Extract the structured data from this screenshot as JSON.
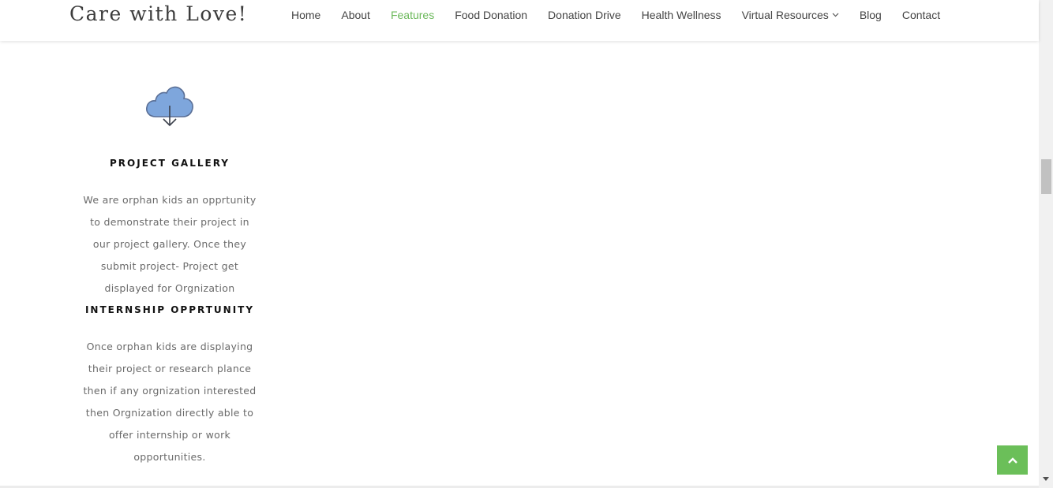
{
  "site": {
    "logo_text": "Care with Love!"
  },
  "nav": {
    "items": [
      {
        "label": "Home",
        "active": false
      },
      {
        "label": "About",
        "active": false
      },
      {
        "label": "Features",
        "active": true
      },
      {
        "label": "Food Donation",
        "active": false
      },
      {
        "label": "Donation Drive",
        "active": false
      },
      {
        "label": "Health Wellness",
        "active": false
      },
      {
        "label": "Virtual Resources",
        "active": false,
        "dropdown": true
      },
      {
        "label": "Blog",
        "active": false
      },
      {
        "label": "Contact",
        "active": false
      }
    ],
    "active_color": "#6bb85a"
  },
  "features": {
    "icon": "cloud-download-icon",
    "items": [
      {
        "title": "PROJECT GALLERY",
        "lines": [
          "We are orphan kids an opprtunity",
          "to demonstrate their project in",
          "our project gallery. Once they",
          "submit project- Project get",
          "displayed for Orgnization"
        ]
      },
      {
        "title": "INTERNSHIP OPPRTUNITY",
        "lines": [
          "Once orphan kids are displaying",
          "their project or research plance",
          "then if any orgnization interested",
          "then Orgnization directly able to",
          "offer internship or work",
          "opportunities."
        ]
      }
    ]
  },
  "back_to_top": {
    "icon": "chevron-up-icon",
    "color": "#6bbf59"
  }
}
